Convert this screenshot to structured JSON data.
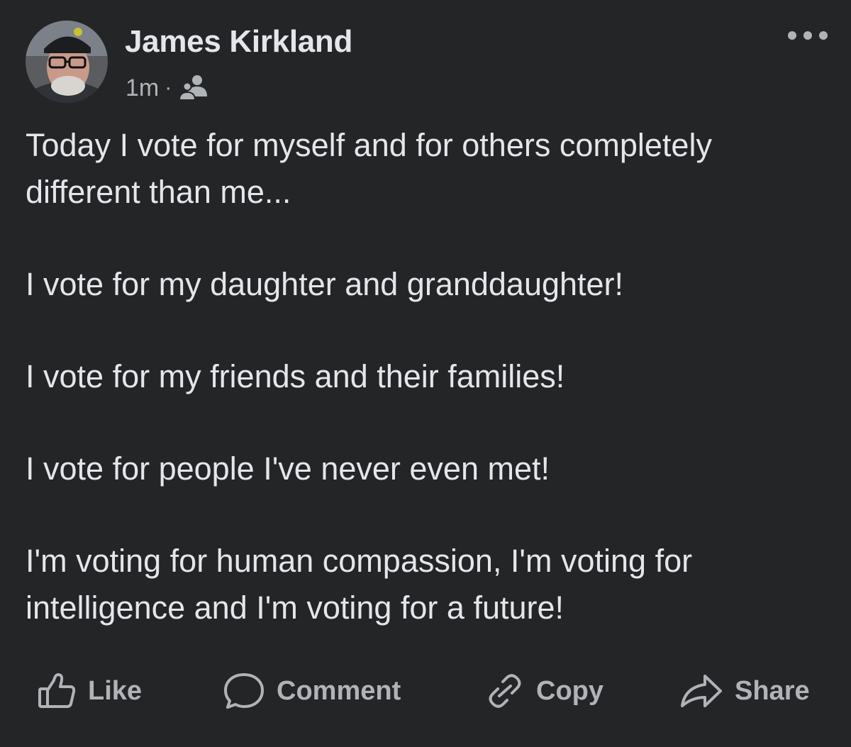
{
  "post": {
    "author_name": "James Kirkland",
    "timestamp": "1m",
    "separator": "·",
    "audience_icon": "friends-icon",
    "more_icon": "more-options-icon",
    "paragraphs": [
      "Today I vote for myself and for others completely different than me...",
      "I vote for my daughter and granddaughter!",
      "I vote for my friends and their families!",
      "I vote for people I've never even met!",
      "I'm voting for human compassion, I'm voting for intelligence and I'm voting for a future!"
    ]
  },
  "actions": {
    "like": {
      "label": "Like",
      "icon": "thumbs-up-icon"
    },
    "comment": {
      "label": "Comment",
      "icon": "speech-bubble-icon"
    },
    "copy": {
      "label": "Copy",
      "icon": "link-icon"
    },
    "share": {
      "label": "Share",
      "icon": "share-arrow-icon"
    }
  },
  "colors": {
    "background": "#242526",
    "primary_text": "#e4e6eb",
    "secondary_text": "#b0b3b8"
  }
}
